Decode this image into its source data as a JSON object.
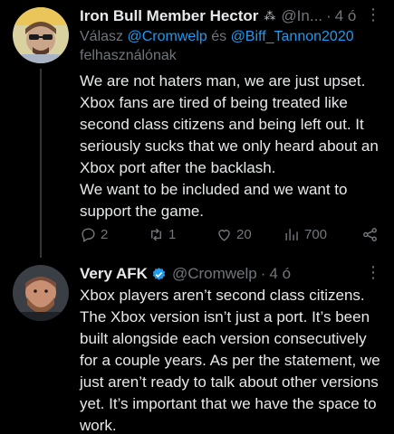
{
  "tweet1": {
    "name": "Iron Bull Member Hector",
    "emoji": "⁂",
    "handle": "@In...",
    "dot": "·",
    "time": "4 ó",
    "reply_prefix": "Válasz",
    "reply_mention1": "@Cromwelp",
    "reply_and": "és",
    "reply_mention2": "@Biff_Tannon2020",
    "reply_suffix": "felhasználónak",
    "body_lines": [
      "We are not haters man, we are just upset.",
      "Xbox fans are tired of being treated like",
      "second class citizens and being left out. It",
      "seriously sucks that we only heard about an",
      "Xbox port after the backlash.",
      "We want to be included and we want to",
      "support the game."
    ],
    "replies": "2",
    "retweets": "1",
    "likes": "20",
    "views": "700"
  },
  "tweet2": {
    "name": "Very AFK",
    "handle": "@Cromwelp",
    "dot": "·",
    "time": "4 ó",
    "body_lines": [
      "Xbox players aren’t second class citizens.",
      "The Xbox version isn’t just a port. It’s been",
      "built alongside each version consecutively",
      "for a couple years. As per the statement, we",
      "just aren’t ready to talk about other versions",
      "yet. It’s important that we have the space to",
      "work."
    ]
  },
  "more_symbol": "⋮",
  "colors": {
    "background": "#000000",
    "text": "#e7e9ea",
    "muted": "#71767b",
    "accent": "#1d9bf0",
    "divider": "#2f3336"
  }
}
